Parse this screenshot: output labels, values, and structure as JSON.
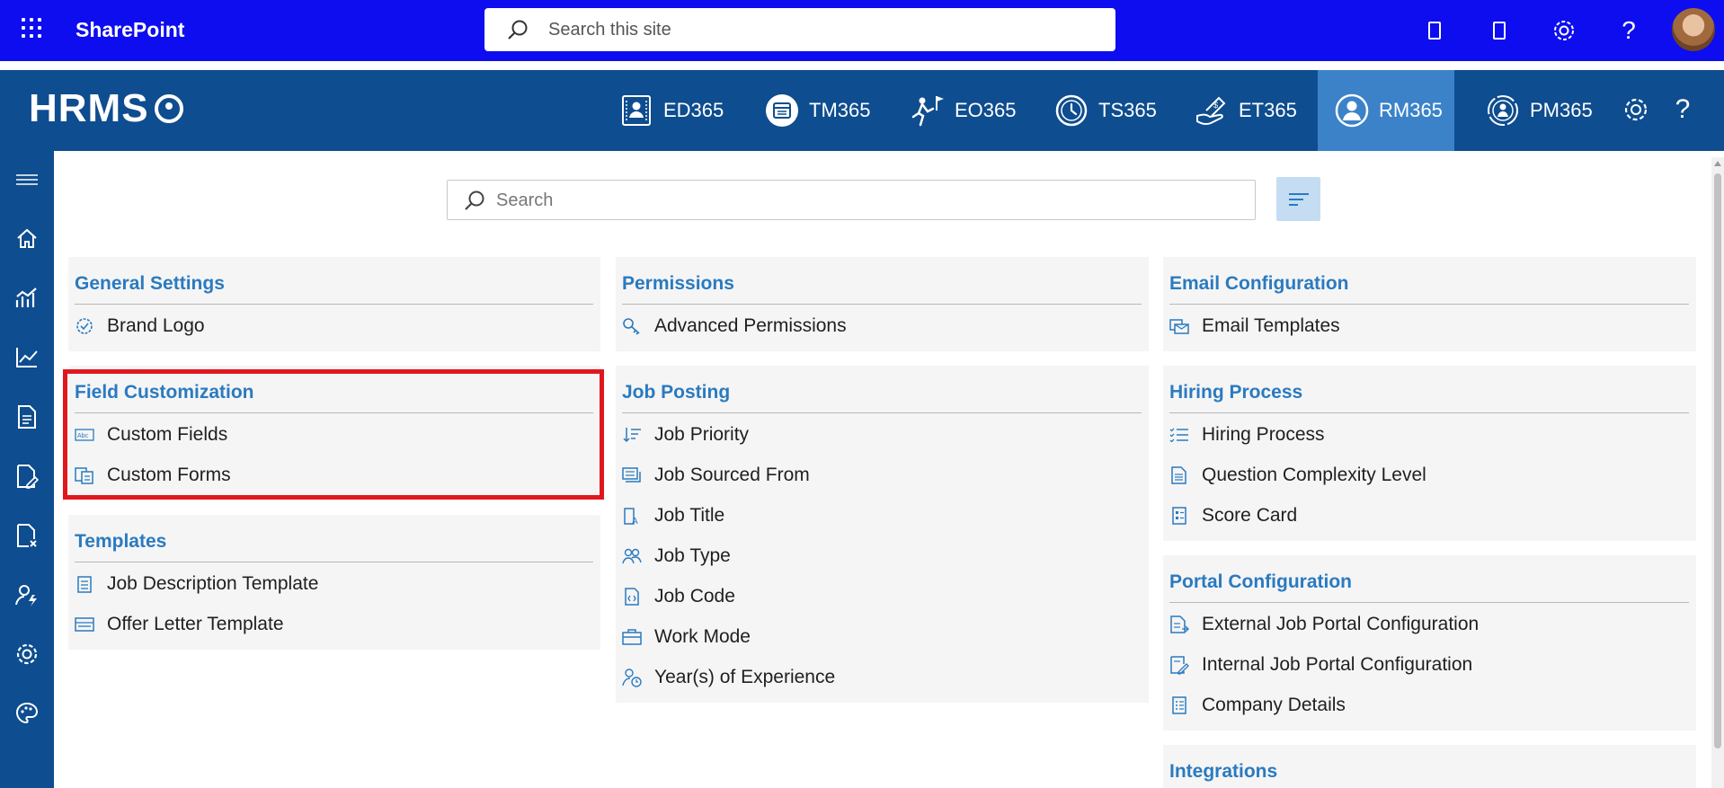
{
  "suitebar": {
    "app_name": "SharePoint",
    "search_placeholder": "Search this site",
    "icons": [
      "mobile-icon",
      "mobile-icon",
      "gear-icon",
      "help-icon",
      "avatar"
    ]
  },
  "appbar": {
    "logo": "HRMS",
    "modules": [
      {
        "label": "ED365",
        "icon": "employee-directory-icon"
      },
      {
        "label": "TM365",
        "icon": "calendar-badge-icon"
      },
      {
        "label": "EO365",
        "icon": "onboarding-flag-icon"
      },
      {
        "label": "TS365",
        "icon": "clock-icon"
      },
      {
        "label": "ET365",
        "icon": "expense-hand-icon"
      },
      {
        "label": "RM365",
        "icon": "recruitment-person-icon",
        "active": true
      },
      {
        "label": "PM365",
        "icon": "performance-person-icon"
      }
    ]
  },
  "main": {
    "search_placeholder": "Search"
  },
  "cards": {
    "general_settings": {
      "title": "General Settings",
      "items": [
        "Brand Logo"
      ]
    },
    "permissions": {
      "title": "Permissions",
      "items": [
        "Advanced Permissions"
      ]
    },
    "email_configuration": {
      "title": "Email Configuration",
      "items": [
        "Email Templates"
      ]
    },
    "field_customization": {
      "title": "Field Customization",
      "items": [
        "Custom Fields",
        "Custom Forms"
      ]
    },
    "job_posting": {
      "title": "Job Posting",
      "items": [
        "Job Priority",
        "Job Sourced From",
        "Job Title",
        "Job Type",
        "Job Code",
        "Work Mode",
        "Year(s) of Experience"
      ]
    },
    "hiring_process": {
      "title": "Hiring Process",
      "items": [
        "Hiring Process",
        "Question Complexity Level",
        "Score Card"
      ]
    },
    "templates": {
      "title": "Templates",
      "items": [
        "Job Description Template",
        "Offer Letter Template"
      ]
    },
    "portal_configuration": {
      "title": "Portal Configuration",
      "items": [
        "External Job Portal Configuration",
        "Internal Job Portal Configuration",
        "Company Details"
      ]
    },
    "integrations": {
      "title": "Integrations"
    }
  },
  "colors": {
    "suitebar": "#0d0df0",
    "appbar": "#0e4d8f",
    "active_module": "#3b82c9",
    "card_title": "#2a7ac0",
    "highlight": "#e0181e"
  }
}
